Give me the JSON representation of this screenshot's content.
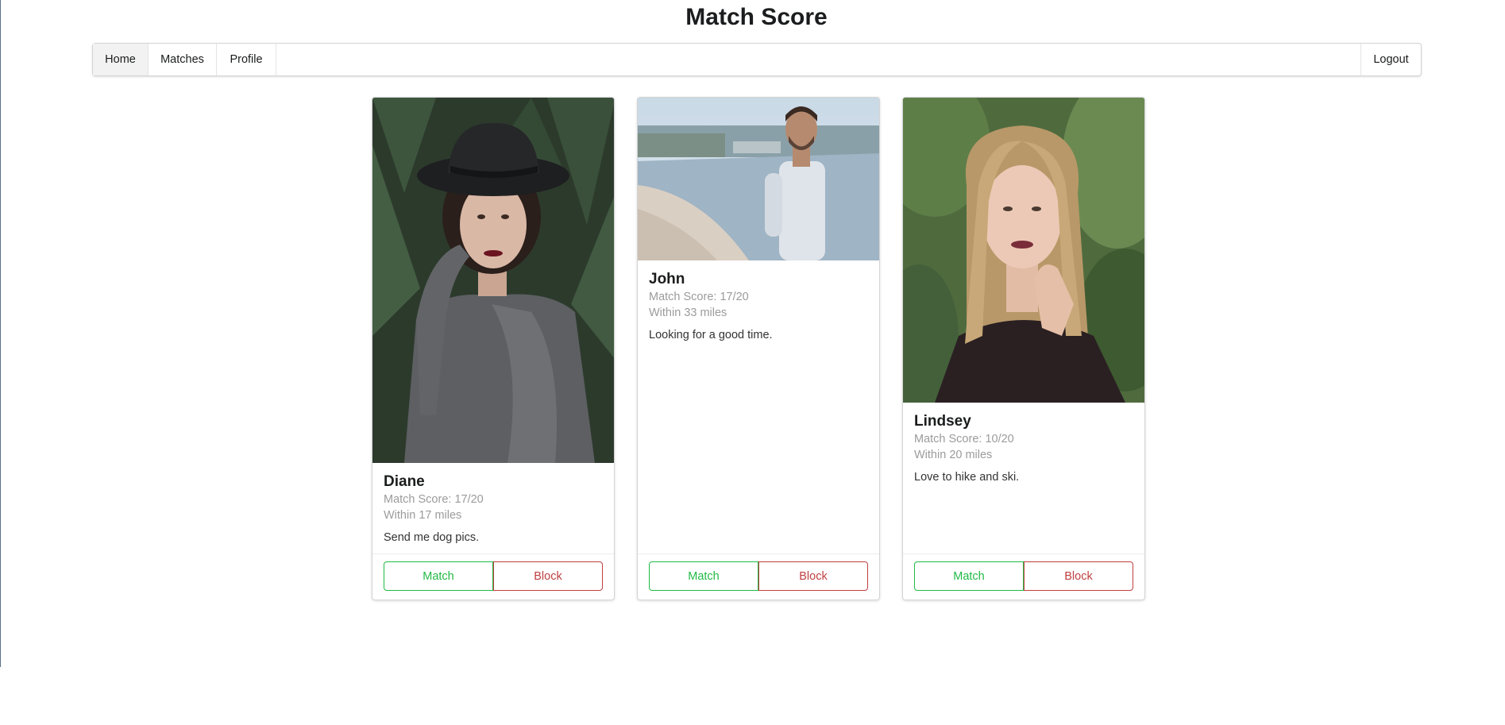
{
  "page": {
    "title": "Match Score"
  },
  "menu": {
    "items": [
      {
        "label": "Home",
        "active": true
      },
      {
        "label": "Matches",
        "active": false
      },
      {
        "label": "Profile",
        "active": false
      }
    ],
    "logout_label": "Logout"
  },
  "cards": [
    {
      "name": "Diane",
      "match_score": "Match Score: 17/20",
      "distance": "Within 17 miles",
      "description": "Send me dog pics.",
      "match_label": "Match",
      "block_label": "Block",
      "photo": "woman-black-hat-portrait"
    },
    {
      "name": "John",
      "match_score": "Match Score: 17/20",
      "distance": "Within 33 miles",
      "description": "Looking for a good time.",
      "match_label": "Match",
      "block_label": "Block",
      "photo": "man-on-beach-portrait"
    },
    {
      "name": "Lindsey",
      "match_score": "Match Score: 10/20",
      "distance": "Within 20 miles",
      "description": "Love to hike and ski.",
      "match_label": "Match",
      "block_label": "Block",
      "photo": "blonde-woman-portrait"
    }
  ],
  "colors": {
    "match": "#21ba45",
    "block": "#c04040",
    "border": "#d4d4d5"
  }
}
